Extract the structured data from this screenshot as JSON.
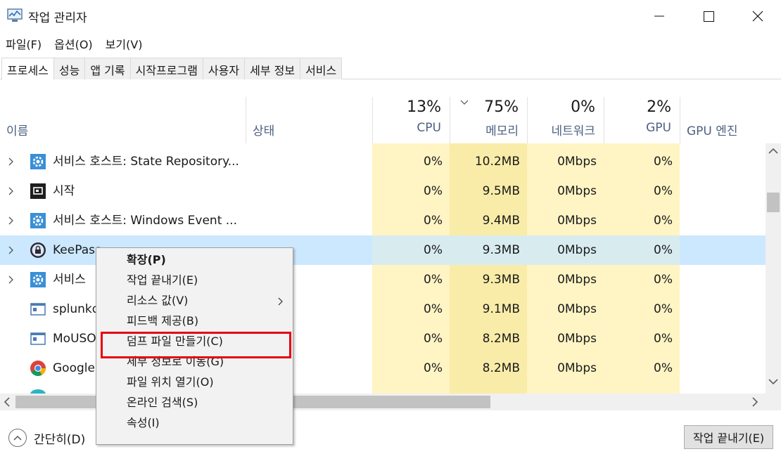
{
  "window": {
    "title": "작업 관리자"
  },
  "menu": [
    "파일(F)",
    "옵션(O)",
    "보기(V)"
  ],
  "tabs": [
    "프로세스",
    "성능",
    "앱 기록",
    "시작프로그램",
    "사용자",
    "세부 정보",
    "서비스"
  ],
  "columns": {
    "name": "이름",
    "status": "상태",
    "cpu": {
      "pct": "13%",
      "label": "CPU"
    },
    "memory": {
      "pct": "75%",
      "label": "메모리"
    },
    "network": {
      "pct": "0%",
      "label": "네트워크"
    },
    "gpu": {
      "pct": "2%",
      "label": "GPU"
    },
    "gpu_engine": "GPU 엔진"
  },
  "rows": [
    {
      "name": "서비스 호스트: State Repository...",
      "icon": "gear-icon",
      "cpu": "0%",
      "mem": "10.2MB",
      "net": "0Mbps",
      "gpu": "0%"
    },
    {
      "name": "시작",
      "icon": "start-icon",
      "cpu": "0%",
      "mem": "9.5MB",
      "net": "0Mbps",
      "gpu": "0%"
    },
    {
      "name": "서비스 호스트: Windows Event ...",
      "icon": "gear-icon",
      "cpu": "0%",
      "mem": "9.4MB",
      "net": "0Mbps",
      "gpu": "0%"
    },
    {
      "name": "KeePass",
      "icon": "lock-icon",
      "cpu": "0%",
      "mem": "9.3MB",
      "net": "0Mbps",
      "gpu": "0%"
    },
    {
      "name": "서비스",
      "icon": "gear-icon",
      "cpu": "0%",
      "mem": "9.3MB",
      "net": "0Mbps",
      "gpu": "0%"
    },
    {
      "name": "splunkd",
      "icon": "window-icon",
      "cpu": "0%",
      "mem": "9.1MB",
      "net": "0Mbps",
      "gpu": "0%"
    },
    {
      "name": "MoUSO",
      "icon": "window-icon",
      "cpu": "0%",
      "mem": "8.2MB",
      "net": "0Mbps",
      "gpu": "0%"
    },
    {
      "name": "Google",
      "icon": "chrome-icon",
      "cpu": "0%",
      "mem": "8.2MB",
      "net": "0Mbps",
      "gpu": "0%"
    }
  ],
  "context_menu": [
    "확장(P)",
    "작업 끝내기(E)",
    "리소스 값(V)",
    "피드백 제공(B)",
    "덤프 파일 만들기(C)",
    "세부 정보로 이동(G)",
    "파일 위치 열기(O)",
    "온라인 검색(S)",
    "속성(I)"
  ],
  "footer": {
    "less_details": "간단히(D)",
    "end_task": "작업 끝내기(E)"
  },
  "colors": {
    "cpu_bg": "#fff4c4",
    "mem_bg": "#f9eca8",
    "selected_row": "#cce8ff",
    "highlight": "#e60012",
    "header_text": "#4d6082"
  }
}
